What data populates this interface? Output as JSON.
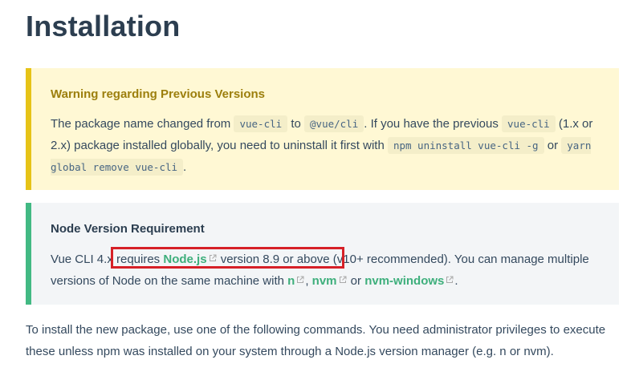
{
  "page_title": "Installation",
  "warning": {
    "title": "Warning regarding Previous Versions",
    "t1": "The package name changed from ",
    "c1": "vue-cli",
    "t2": " to ",
    "c2": "@vue/cli",
    "t3": ". If you have the previous ",
    "c3": "vue-cli",
    "t4": " (1.x or 2.x) package installed globally, you need to uninstall it first with ",
    "c4": "npm uninstall vue-cli -g",
    "t5": " or ",
    "c5": "yarn global remove vue-cli",
    "t6": "."
  },
  "tip": {
    "title": "Node Version Requirement",
    "t1": "Vue CLI 4.x requires ",
    "link_node": "Node.js",
    "t2": " version 8.9 or above (v10+ recommended). You can manage multiple versions of Node on the same machine with ",
    "link_n": "n",
    "t3": ", ",
    "link_nvm": "nvm",
    "t4": " or ",
    "link_nvmw": "nvm-windows",
    "t5": "."
  },
  "paragraph": "To install the new package, use one of the following commands. You need administrator privileges to execute these unless npm was installed on your system through a Node.js version manager (e.g. n or nvm).",
  "colors": {
    "warning_border": "#e6c317",
    "tip_border": "#42b983",
    "link": "#3eaf7c",
    "highlight": "#d62027"
  },
  "icons": [
    "external-link-icon"
  ]
}
